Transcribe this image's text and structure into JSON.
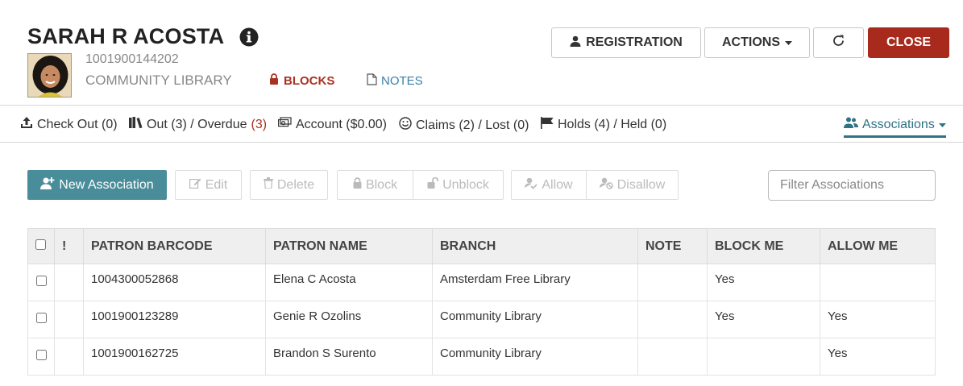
{
  "patron": {
    "name": "SARAH R ACOSTA",
    "barcode": "1001900144202",
    "library": "COMMUNITY LIBRARY",
    "blocks_label": "BLOCKS",
    "notes_label": "NOTES"
  },
  "header_buttons": {
    "registration": "REGISTRATION",
    "actions": "ACTIONS",
    "close": "CLOSE"
  },
  "nav": {
    "checkout": "Check Out (0)",
    "out": "Out (3) / Overdue",
    "overdue_count": "(3)",
    "account": "Account ($0.00)",
    "claims": "Claims (2) / Lost (0)",
    "holds": "Holds (4) / Held (0)",
    "associations": "Associations"
  },
  "toolbar": {
    "new_association": "New Association",
    "edit": "Edit",
    "delete": "Delete",
    "block": "Block",
    "unblock": "Unblock",
    "allow": "Allow",
    "disallow": "Disallow",
    "filter_placeholder": "Filter Associations"
  },
  "table": {
    "headers": {
      "warn": "!",
      "barcode": "PATRON BARCODE",
      "name": "PATRON NAME",
      "branch": "BRANCH",
      "note": "NOTE",
      "block_me": "BLOCK ME",
      "allow_me": "ALLOW ME"
    },
    "rows": [
      {
        "barcode": "1004300052868",
        "name": "Elena C Acosta",
        "branch": "Amsterdam Free Library",
        "note": "",
        "block_me": "Yes",
        "allow_me": ""
      },
      {
        "barcode": "1001900123289",
        "name": "Genie R Ozolins",
        "branch": "Community Library",
        "note": "",
        "block_me": "Yes",
        "allow_me": "Yes"
      },
      {
        "barcode": "1001900162725",
        "name": "Brandon S Surento",
        "branch": "Community Library",
        "note": "",
        "block_me": "",
        "allow_me": "Yes"
      }
    ]
  },
  "colors": {
    "close_button": "#a82a1c",
    "primary_teal": "#4a8d9a",
    "blocks_red": "#a83222",
    "link_blue": "#3a7fa8"
  }
}
